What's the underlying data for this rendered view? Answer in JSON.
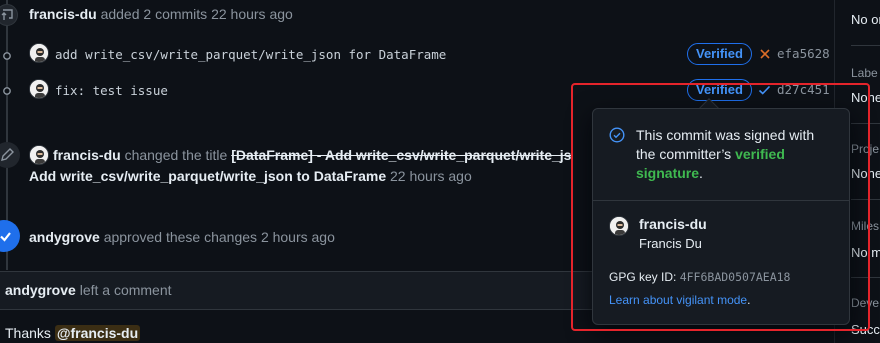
{
  "timeline": {
    "commits_event": {
      "author": "francis-du",
      "action": "added 2 commits",
      "time": "22 hours ago"
    },
    "commits": [
      {
        "message": "add write_csv/write_parquet/write_json for DataFrame",
        "badge": "Verified",
        "status": "failure",
        "sha": "efa5628"
      },
      {
        "message": "fix: test issue",
        "badge": "Verified",
        "status": "success",
        "sha": "d27c451"
      }
    ],
    "title_change": {
      "author": "francis-du",
      "action": "changed the title",
      "old_title": "[DataFrame] - Add write_csv/write_parquet/write_js",
      "new_title": "Add write_csv/write_parquet/write_json to DataFrame",
      "time": "22 hours ago"
    },
    "approval": {
      "author": "andygrove",
      "action": "approved these changes",
      "time": "2 hours ago"
    },
    "comment": {
      "author": "andygrove",
      "action": "left a comment",
      "body_prefix": "Thanks",
      "mention": "@francis-du"
    }
  },
  "popover": {
    "message_prefix": "This commit was signed with the committer’s",
    "verified_text": "verified signature",
    "period": ".",
    "user_login": "francis-du",
    "user_name": "Francis Du",
    "gpg_label": "GPG key ID:",
    "gpg_key": "4FF6BAD0507AEA18",
    "learn_link": "Learn about vigilant mode",
    "learn_period": "."
  },
  "sidebar": {
    "items": [
      {
        "heading": "",
        "value": "No or"
      },
      {
        "heading": "Labe",
        "value": "None"
      },
      {
        "heading": "Proje",
        "value": "None"
      },
      {
        "heading": "Miles",
        "value": "No m"
      },
      {
        "heading": "Deve",
        "value": "Succ"
      }
    ]
  },
  "colors": {
    "background": "#0d1117",
    "verified_blue": "#4493f8",
    "success_green": "#3fb950",
    "failure_orange": "#db6d28",
    "approved_blue": "#1f6feb",
    "highlight_red": "#e5242b"
  },
  "icons": {
    "commit_push": "repo-push-icon",
    "commit_node": "git-commit-icon",
    "edit": "pencil-icon",
    "approved": "check-circle-fill-icon",
    "failure": "x-icon",
    "success": "check-icon",
    "verified": "verified-icon"
  }
}
